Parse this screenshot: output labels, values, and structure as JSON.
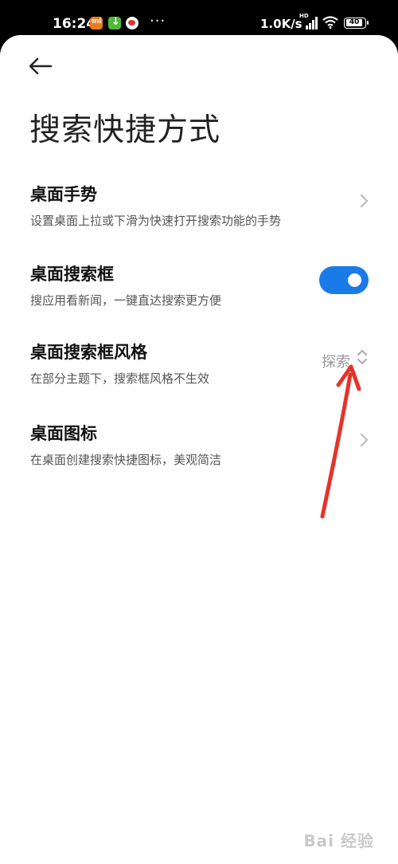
{
  "status_bar": {
    "time": "16:24",
    "dots": "···",
    "net_speed": "1.0K/s",
    "hd": "HD",
    "battery": "40"
  },
  "header": {
    "title": "搜索快捷方式"
  },
  "settings": [
    {
      "title": "桌面手势",
      "subtitle": "设置桌面上拉或下滑为快速打开搜索功能的手势",
      "control": "chevron"
    },
    {
      "title": "桌面搜索框",
      "subtitle": "搜应用看新闻，一键直达搜索更方便",
      "control": "toggle",
      "toggle_on": true
    },
    {
      "title": "桌面搜索框风格",
      "subtitle": "在部分主题下，搜索框风格不生效",
      "control": "dropdown",
      "value": "探索"
    },
    {
      "title": "桌面图标",
      "subtitle": "在桌面创建搜索快捷图标，美观简洁",
      "control": "chevron"
    }
  ],
  "watermark": "Bai 经验",
  "colors": {
    "accent": "#1a7ae8",
    "annotation_arrow": "#e5332a"
  }
}
